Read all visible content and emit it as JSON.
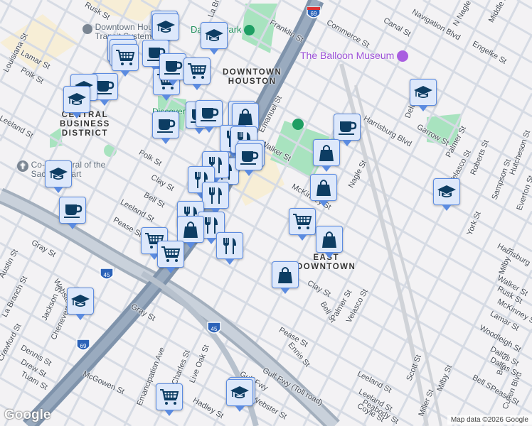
{
  "streets": [
    "Lamar St",
    "Louisiana St",
    "Polk St",
    "Leeland St",
    "Polk St",
    "Clay St",
    "Bell St",
    "Leeland St",
    "Pease St",
    "Gray St",
    "Webster St",
    "Austin St",
    "La Branch St",
    "Crawford St",
    "Jackson St",
    "Chenevert St",
    "Dennis St",
    "Drew St",
    "Tuam St",
    "Gray St",
    "McGowen St",
    "Emancipation Ave",
    "St Charles St",
    "Live Oak St",
    "Hadley St",
    "Webster St",
    "Gulf Fwy",
    "Gulf Fwy (Toll road)",
    "Pease St",
    "Ennis St",
    "Leeland St",
    "Bell St",
    "Clay St",
    "Palmer St",
    "Velasco St",
    "McKinney St",
    "Nagle St",
    "Walker St",
    "Emanuel St",
    "Harrisburg Blvd",
    "Garrow St",
    "Deland St",
    "Palmer St",
    "Velasco St",
    "Roberts St",
    "Sampson St",
    "York St",
    "Milby St",
    "Scott St",
    "Commerce St",
    "Canal St",
    "Navigation Blvd",
    "N Nagle St",
    "Engelke St",
    "Middle St",
    "Franklin St",
    "La Branch St",
    "Rusk St",
    "Walker St",
    "Lamar St",
    "Woodleigh St",
    "Dallas St",
    "Bell St",
    "Leeland St",
    "Peabody St",
    "Coyle St",
    "Miller St",
    "Milby St",
    "Cullen Blvd",
    "Hutcheson St",
    "Everton St",
    "Harrisburg",
    "Rusk St",
    "McKinney St",
    "Dallas St",
    "Bell St",
    "Pease St"
  ],
  "districts": {
    "cbd": "CENTRAL\nBUSINESS\nDISTRICT",
    "downtown": "DOWNTOWN\nHOUSTON",
    "east": "EAST\nDOWNTOWN"
  },
  "pois": {
    "transit": "Downtown Houston Transit System",
    "park": "Discovery Green",
    "dpark": "Dakota Park",
    "museum": "The Balloon Museum",
    "cathedral": "Co-Cathedral of the Sacred Heart"
  },
  "shields": {
    "i69": "69",
    "i45": "45"
  },
  "markers": {
    "types": [
      "school-icon",
      "coffee-icon",
      "shopping-cart-icon",
      "shopping-bag-icon",
      "restaurant-icon"
    ]
  },
  "footer": {
    "logo": "Google",
    "attribution": "Map data ©2026 Google"
  },
  "colors": {
    "marker_fill": "#dde8fb",
    "marker_border": "#5b8be0",
    "icon": "#0d3d63",
    "park": "#a8e3bf",
    "freeway": "#8fa2b8"
  }
}
